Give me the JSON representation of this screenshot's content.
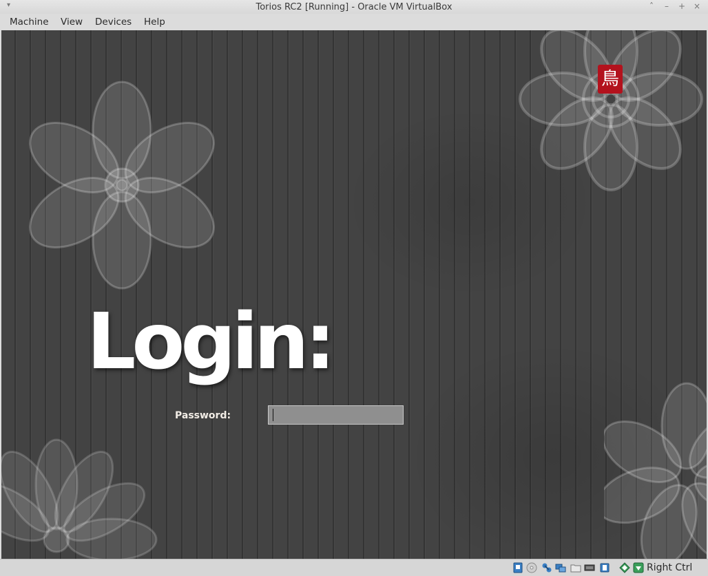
{
  "window": {
    "title": "Torios RC2 [Running] - Oracle VM VirtualBox",
    "controls": [
      "minimize",
      "maximize",
      "close"
    ]
  },
  "menubar": {
    "items": [
      "Machine",
      "View",
      "Devices",
      "Help"
    ]
  },
  "guest": {
    "heading": "Login:",
    "password_label": "Password:",
    "password_value": "",
    "logo_glyph": "鳥",
    "logo_color": "#b3121d",
    "background_color": "#434343"
  },
  "statusbar": {
    "icons": [
      "hard-disk-icon",
      "optical-drive-icon",
      "network-icon",
      "shared-network-icon",
      "shared-folders-icon",
      "display-icon",
      "video-capture-icon",
      "usb-icon",
      "mouse-integration-icon",
      "keyboard-capture-icon"
    ],
    "host_key": "Right Ctrl"
  }
}
